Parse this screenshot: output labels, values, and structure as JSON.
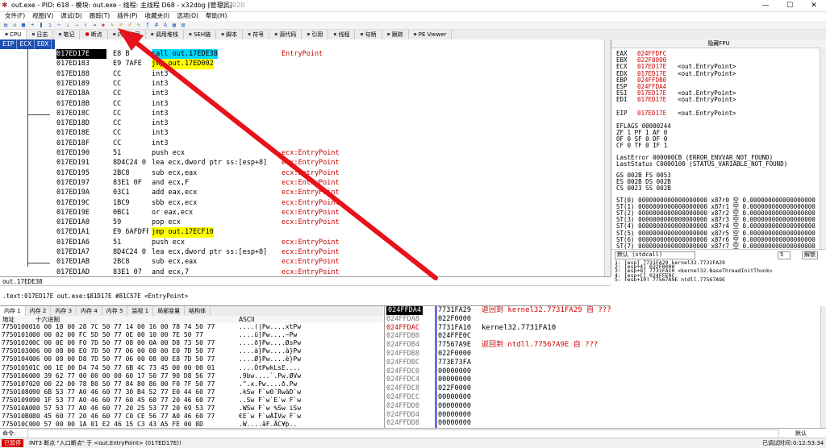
{
  "window": {
    "title": "out.exe - PID: 618 - 模块: out.exe - 线程: 主线程 D68 - x32dbg [管理员]",
    "date": "Jul 25 2020",
    "minimize": "—",
    "maximize": "☐",
    "close": "✕"
  },
  "menu": [
    "文件(F)",
    "视图(V)",
    "调试(D)",
    "跟踪(T)",
    "插件(P)",
    "收藏夹(I)",
    "选项(O)",
    "帮助(H)"
  ],
  "tabs": [
    {
      "label": "CPU",
      "icon": "cpu-icon"
    },
    {
      "label": "日志",
      "icon": "log-icon"
    },
    {
      "label": "笔记",
      "icon": "notes-icon"
    },
    {
      "label": "断点",
      "icon": "breakpoint-icon"
    },
    {
      "label": "内存布局",
      "icon": "memory-map-icon"
    },
    {
      "label": "调用堆栈",
      "icon": "call-stack-icon"
    },
    {
      "label": "SEH链",
      "icon": "seh-icon"
    },
    {
      "label": "脚本",
      "icon": "script-icon"
    },
    {
      "label": "符号",
      "icon": "symbols-icon"
    },
    {
      "label": "源代码",
      "icon": "source-icon"
    },
    {
      "label": "引用",
      "icon": "references-icon"
    },
    {
      "label": "线程",
      "icon": "threads-icon"
    },
    {
      "label": "句柄",
      "icon": "handles-icon"
    },
    {
      "label": "跟踪",
      "icon": "trace-icon"
    },
    {
      "label": "PE Viewer",
      "icon": "pe-viewer-icon"
    }
  ],
  "cpu": {
    "reg_labels": [
      "EIP",
      "ECX",
      "EDX"
    ],
    "rows": [
      {
        "addr": "017ED17E",
        "bytes": "E8 B",
        "instr": "call out.17EDE38",
        "comment": "EntryPoint",
        "hl": "call",
        "cur": true
      },
      {
        "addr": "017ED183",
        "bytes": "E9 7AFE",
        "instr": "jmp out.17ED002",
        "comment": "",
        "hl": "jmp"
      },
      {
        "addr": "017ED188",
        "bytes": "CC",
        "instr": "int3",
        "comment": ""
      },
      {
        "addr": "017ED189",
        "bytes": "CC",
        "instr": "int3",
        "comment": ""
      },
      {
        "addr": "017ED18A",
        "bytes": "CC",
        "instr": "int3",
        "comment": ""
      },
      {
        "addr": "017ED18B",
        "bytes": "CC",
        "instr": "int3",
        "comment": ""
      },
      {
        "addr": "017ED18C",
        "bytes": "CC",
        "instr": "int3",
        "comment": ""
      },
      {
        "addr": "017ED18D",
        "bytes": "CC",
        "instr": "int3",
        "comment": ""
      },
      {
        "addr": "017ED18E",
        "bytes": "CC",
        "instr": "int3",
        "comment": ""
      },
      {
        "addr": "017ED18F",
        "bytes": "CC",
        "instr": "int3",
        "comment": ""
      },
      {
        "addr": "017ED190",
        "bytes": "51",
        "instr": "push ecx",
        "comment": "ecx:EntryPoint"
      },
      {
        "addr": "017ED191",
        "bytes": "8D4C24 0",
        "instr": "lea ecx,dword ptr ss:[esp+8]",
        "comment": "ecx:EntryPoint"
      },
      {
        "addr": "017ED195",
        "bytes": "2BC8",
        "instr": "sub ecx,eax",
        "comment": "ecx:EntryPoint"
      },
      {
        "addr": "017ED197",
        "bytes": "83E1 0F",
        "instr": "and ecx,F",
        "comment": "ecx:EntryPoint"
      },
      {
        "addr": "017ED19A",
        "bytes": "03C1",
        "instr": "add eax,ecx",
        "comment": "ecx:EntryPoint"
      },
      {
        "addr": "017ED19C",
        "bytes": "1BC9",
        "instr": "sbb ecx,ecx",
        "comment": "ecx:EntryPoint"
      },
      {
        "addr": "017ED19E",
        "bytes": "0BC1",
        "instr": "or eax,ecx",
        "comment": "ecx:EntryPoint"
      },
      {
        "addr": "017ED1A0",
        "bytes": "59",
        "instr": "pop ecx",
        "comment": "ecx:EntryPoint"
      },
      {
        "addr": "017ED1A1",
        "bytes": "E9 6AFDFF",
        "instr": "jmp out.17ECF10",
        "comment": "",
        "hl": "jmp"
      },
      {
        "addr": "017ED1A6",
        "bytes": "51",
        "instr": "push ecx",
        "comment": "ecx:EntryPoint"
      },
      {
        "addr": "017ED1A7",
        "bytes": "8D4C24 0",
        "instr": "lea ecx,dword ptr ss:[esp+8]",
        "comment": "ecx:EntryPoint"
      },
      {
        "addr": "017ED1AB",
        "bytes": "2BC8",
        "instr": "sub ecx,eax",
        "comment": "ecx:EntryPoint"
      },
      {
        "addr": "017ED1AD",
        "bytes": "83E1 07",
        "instr": "and ecx,7",
        "comment": "ecx:EntryPoint"
      }
    ]
  },
  "registers": {
    "title": "隐藏FPU",
    "gp": [
      [
        "EAX",
        "024FFDFC",
        ""
      ],
      [
        "EBX",
        "022F0000",
        ""
      ],
      [
        "ECX",
        "017ED17E",
        "<out.EntryPoint>"
      ],
      [
        "EDX",
        "017ED17E",
        "<out.EntryPoint>"
      ],
      [
        "EBP",
        "024FFDB0",
        ""
      ],
      [
        "ESP",
        "024FFDA4",
        ""
      ],
      [
        "ESI",
        "017ED17E",
        "<out.EntryPoint>"
      ],
      [
        "EDI",
        "017ED17E",
        "<out.EntryPoint>"
      ]
    ],
    "eip": [
      "EIP",
      "017ED17E",
      "<out.EntryPoint>"
    ],
    "eflags": "EFLAGS   00000244",
    "flags": [
      "ZF 1  PF 1  AF 0",
      "OF 0  SF 0  DF 0",
      "CF 0  TF 0  IF 1"
    ],
    "lasterror": "LastError  000000CB (ERROR_ENVVAR_NOT_FOUND)",
    "laststatus": "LastStatus C0000100 (STATUS_VARIABLE_NOT_FOUND)",
    "segs": [
      "GS 002B  FS 0053",
      "ES 002B  DS 002B",
      "CS 0023  SS 002B"
    ],
    "st": [
      "ST(0) 0000000000000000000 x87r0 空 0.000000000000000000",
      "ST(1) 0000000000000000000 x87r1 空 0.000000000000000000",
      "ST(2) 0000000000000000000 x87r2 空 0.000000000000000000",
      "ST(3) 0000000000000000000 x87r3 空 0.000000000000000000",
      "ST(4) 0000000000000000000 x87r4 空 0.000000000000000000",
      "ST(5) 0000000000000000000 x87r5 空 0.000000000000000000",
      "ST(6) 0000000000000000000 x87r6 空 0.000000000000000000",
      "ST(7) 0000000000000000000 x87r7 空 0.000000000000000000"
    ]
  },
  "callconv": {
    "label": "默认 (stdcall)",
    "count": "5",
    "unlock": "解锁",
    "args": [
      "1: [esp] 7731FA29 kernel32.7731FA29",
      "2: [esp+4] 022F0000",
      "3: [esp+8] 7731FA10 <kernel32.BaseThreadInitThunk>",
      "4: [esp+C] 024FFE0C",
      "5: [esp+10] 77567A9E ntdll.77567A9E"
    ]
  },
  "midbar": "out.17EDE38",
  "infobar": ".text:017ED17E out.exe:$81D17E #81C57E <EntryPoint>",
  "dumptabs": [
    "内存 1",
    "内存 2",
    "内存 3",
    "内存 4",
    "内存 5",
    "监视 1",
    "局部变量",
    "结构体"
  ],
  "dumphdr": {
    "addr": "地址",
    "hex": "十六进制",
    "ascii": "ASCII"
  },
  "dump": [
    {
      "addr": "77501000",
      "hex": "16 00 18 00 28 7C 50 77 14 00 16 00 78 74 50 77",
      "ascii": "....(|Pw....xtPw"
    },
    {
      "addr": "77501010",
      "hex": "00 00 02 00 FC 5D 50 77 0E 00 10 00 7E 50 77",
      "ascii": "....ü]Pw....~Pw"
    },
    {
      "addr": "77501020",
      "hex": "0C 00 0E 00 F0 7D 50 77 08 00 0A 00 D8 73 50 77",
      "ascii": "....ð}Pw....ØsPw"
    },
    {
      "addr": "77501030",
      "hex": "06 00 08 00 E0 7D 50 77 06 00 08 00 E0 7D 50 77",
      "ascii": "....à}Pw....à}Pw"
    },
    {
      "addr": "77501040",
      "hex": "06 00 08 00 D8 7D 50 77 06 00 08 00 E8 7D 50 77",
      "ascii": "....Ø}Pw....è}Pw"
    },
    {
      "addr": "77501050",
      "hex": "1C 00 1E 00 D4 74 50 77 6B 4C 73 45 00 00 00 01",
      "ascii": "....ÔtPwkLsE...."
    },
    {
      "addr": "77501060",
      "hex": "00 39 62 77 00 00 00 00 60 17 50 77 90 D8 56 77",
      "ascii": ".9bw....`.Pw.ØVw"
    },
    {
      "addr": "77501070",
      "hex": "20 00 22 00 78 80 50 77 84 80 86 00 F0 7F 50 77",
      "ascii": " .\".x.Pw....ð.Pw"
    },
    {
      "addr": "77501080",
      "hex": "90 6B 53 77 A0 46 60 77 30 B4 52 77 E0 44 60 77",
      "ascii": ".kSw F`w0´RwàD`w"
    },
    {
      "addr": "77501090",
      "hex": "90 1F 53 77 A0 46 60 77 60 45 60 77 20 46 60 77",
      "ascii": "..Sw F`w`E`w F`w"
    },
    {
      "addr": "775010A0",
      "hex": "00 57 53 77 A0 46 60 77 20 25 53 77 20 69 53 77",
      "ascii": ".WSw F`w %Sw iSw"
    },
    {
      "addr": "775010B0",
      "hex": "80 45 60 77 20 46 60 77 C0 CE 56 77 A0 46 60 77",
      "ascii": "€E`w F`wÀÎVw F`w"
    },
    {
      "addr": "775010C0",
      "hex": "00 57 00 00 1A 01 E2 46 15 C3 43 A5 FE 00 8D",
      "ascii": ".W....âF.ÃC¥þ.."
    },
    {
      "addr": "775010D0",
      "hex": "EE E3 D3 F0 06 00 00 00 5C 74 50 77 01 00 00 00",
      "ascii": "îãÓð....\\tPw...."
    }
  ],
  "stack": [
    {
      "addr": "024FFDA4",
      "val": "7731FA29",
      "comment": "返回到 kernel32.7731FA29 自 ???",
      "cur": true
    },
    {
      "addr": "024FFDA8",
      "val": "022F0000",
      "comment": ""
    },
    {
      "addr": "024FFDAC",
      "val": "7731FA10",
      "comment": "kernel32.7731FA10",
      "red": true
    },
    {
      "addr": "024FFDB0",
      "val": "024FFE0C",
      "comment": ""
    },
    {
      "addr": "024FFDB4",
      "val": "77567A9E",
      "comment": "返回到 ntdll.77567A9E 自 ???"
    },
    {
      "addr": "024FFDB8",
      "val": "022F0000",
      "comment": ""
    },
    {
      "addr": "024FFDBC",
      "val": "773E73FA",
      "comment": ""
    },
    {
      "addr": "024FFDC0",
      "val": "00000000",
      "comment": ""
    },
    {
      "addr": "024FFDC4",
      "val": "00000000",
      "comment": ""
    },
    {
      "addr": "024FFDC8",
      "val": "022F0000",
      "comment": ""
    },
    {
      "addr": "024FFDCC",
      "val": "00000000",
      "comment": ""
    },
    {
      "addr": "024FFDD0",
      "val": "00000000",
      "comment": ""
    },
    {
      "addr": "024FFDD4",
      "val": "00000000",
      "comment": ""
    },
    {
      "addr": "024FFDD8",
      "val": "00000000",
      "comment": ""
    }
  ],
  "cmd": {
    "label": "命令:",
    "default": "默认"
  },
  "status": {
    "paused": "已暂停",
    "msg": "INT3 断点 \"入口断点\" 于 <out.EntryPoint> (017ED17E)!",
    "time_label": "已调试时间:",
    "time": "0:12:53:34"
  },
  "colors": {
    "accent": "#1e4fb2",
    "annotation_arrow": "#e8121b",
    "call_hl": "#00d8ff",
    "jmp_hl": "#ffff00"
  }
}
